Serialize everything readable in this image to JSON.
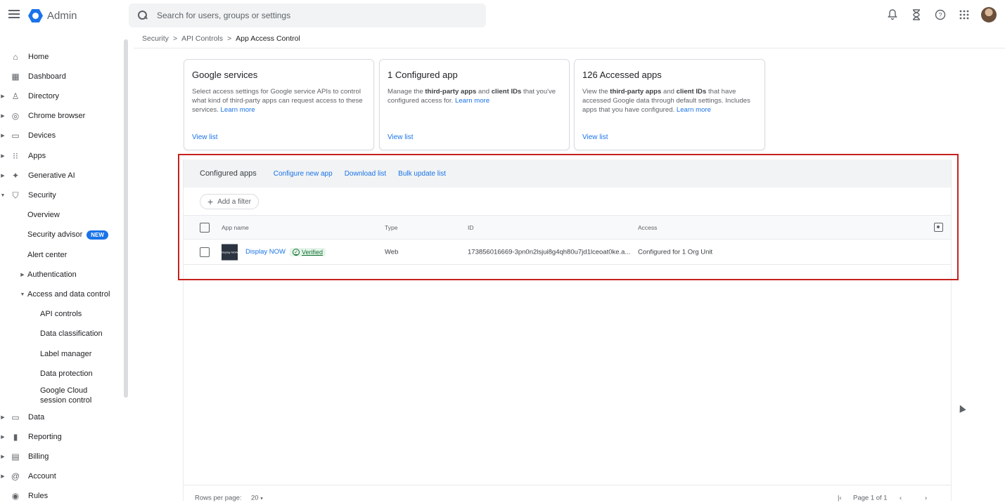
{
  "app": {
    "title": "Admin",
    "brand_color": "#1a73e8"
  },
  "search": {
    "placeholder": "Search for users, groups or settings"
  },
  "topbar_icons": [
    "bell-icon",
    "hourglass-icon",
    "help-icon",
    "apps-grid-icon",
    "account-avatar"
  ],
  "sidebar": {
    "items": [
      {
        "label": "Home",
        "icon": "home-icon"
      },
      {
        "label": "Dashboard",
        "icon": "dashboard-icon"
      },
      {
        "label": "Directory",
        "icon": "person-icon",
        "expandable": true
      },
      {
        "label": "Chrome browser",
        "icon": "chrome-icon",
        "expandable": true
      },
      {
        "label": "Devices",
        "icon": "devices-icon",
        "expandable": true
      },
      {
        "label": "Apps",
        "icon": "apps-icon",
        "expandable": true
      },
      {
        "label": "Generative AI",
        "icon": "sparkle-icon",
        "expandable": true
      },
      {
        "label": "Security",
        "icon": "shield-icon",
        "expanded": true
      }
    ],
    "security_children": [
      {
        "label": "Overview"
      },
      {
        "label": "Security advisor",
        "badge": "NEW"
      },
      {
        "label": "Alert center"
      },
      {
        "label": "Authentication",
        "expandable": true
      },
      {
        "label": "Access and data control",
        "expanded": true
      }
    ],
    "access_children": [
      {
        "label": "API controls"
      },
      {
        "label": "Data classification"
      },
      {
        "label": "Label manager"
      },
      {
        "label": "Data protection"
      },
      {
        "label": "Google Cloud session control"
      }
    ],
    "bottom_items": [
      {
        "label": "Data",
        "icon": "folder-icon"
      },
      {
        "label": "Reporting",
        "icon": "bar-chart-icon"
      },
      {
        "label": "Billing",
        "icon": "card-icon"
      },
      {
        "label": "Account",
        "icon": "at-icon"
      },
      {
        "label": "Rules",
        "icon": "rules-icon"
      }
    ]
  },
  "breadcrumb": {
    "items": [
      "Security",
      "API Controls",
      "App Access Control"
    ],
    "separator": ">"
  },
  "cards": [
    {
      "title": "Google services",
      "desc": "Select access settings for Google service APIs to control what kind of third-party apps can request access to these services.",
      "learn_more": "Learn more",
      "view_list": "View list"
    },
    {
      "title": "1 Configured app",
      "desc_pre": "Manage the ",
      "bold1": "third-party apps",
      "desc_mid": " and ",
      "bold2": "client IDs",
      "desc_post": " that you've configured access for.",
      "learn_more": "Learn more",
      "view_list": "View list"
    },
    {
      "title": "126 Accessed apps",
      "desc_pre": "View the ",
      "bold1": "third-party apps",
      "desc_mid": " and ",
      "bold2": "client IDs",
      "desc_post": " that have accessed Google data through default settings. Includes apps that you have configured.",
      "learn_more": "Learn more",
      "view_list": "View list"
    }
  ],
  "configured_apps": {
    "title": "Configured apps",
    "actions": [
      "Configure new app",
      "Download list",
      "Bulk update list"
    ],
    "filter_label": "Add a filter",
    "columns": [
      "App name",
      "Type",
      "ID",
      "Access"
    ],
    "rows": [
      {
        "thumb_text": "Display NOW",
        "app_name": "Display NOW",
        "verified": "Verified",
        "type": "Web",
        "id": "173856016669-3pn0n2lsjui8g4qh80u7jd1lceoat0ke.a...",
        "access": "Configured for 1 Org Unit"
      }
    ]
  },
  "footer": {
    "rows_label": "Rows per page:",
    "rows_value": "20",
    "page_label": "Page 1 of 1"
  },
  "highlight_color": "#c5221f"
}
